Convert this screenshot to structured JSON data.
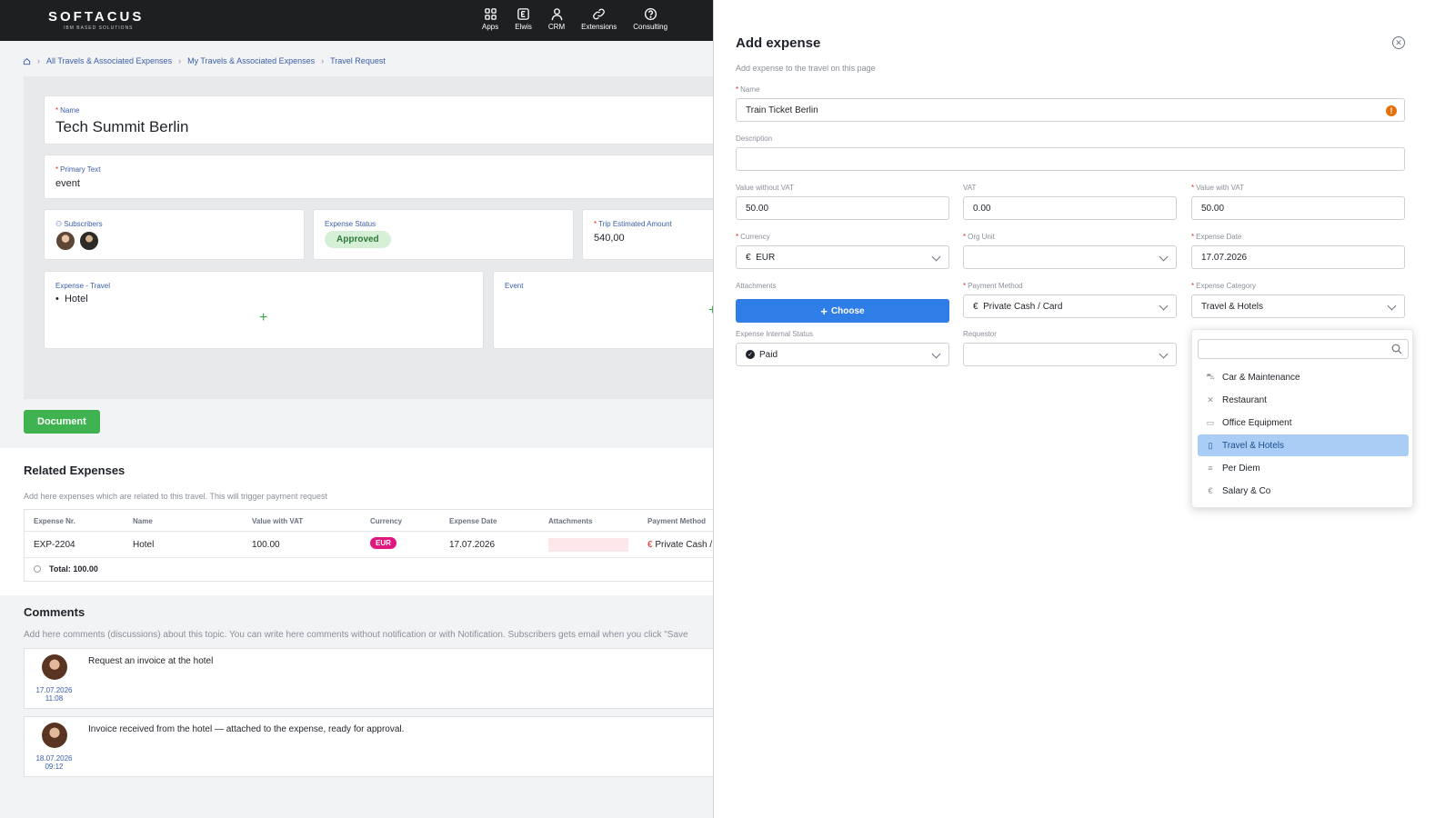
{
  "header": {
    "brand": "SOFTACUS",
    "brand_sub": "IBM BASED SOLUTIONS",
    "nav": [
      {
        "label": "Apps",
        "icon": "grid-icon"
      },
      {
        "label": "Elwis",
        "icon": "elwis-icon"
      },
      {
        "label": "CRM",
        "icon": "person-icon"
      },
      {
        "label": "Extensions",
        "icon": "link-icon"
      },
      {
        "label": "Consulting",
        "icon": "help-icon"
      }
    ]
  },
  "breadcrumb": [
    "All Travels & Associated Expenses",
    "My Travels & Associated Expenses",
    "Travel Request"
  ],
  "travel": {
    "name_label": "Name",
    "name": "Tech Summit Berlin",
    "primary_label": "Primary Text",
    "primary": "event",
    "subscribers_label": "Subscribers",
    "status_label": "Expense Status",
    "status": "Approved",
    "amount_label": "Trip Estimated Amount",
    "amount": "540,00",
    "expense_travel_label": "Expense - Travel",
    "expense_travel_items": [
      "Hotel"
    ],
    "event_label": "Event",
    "document_button": "Document"
  },
  "related": {
    "title": "Related Expenses",
    "desc": "Add here expenses which are related to this travel. This will trigger payment request",
    "columns": [
      "Expense Nr.",
      "Name",
      "Value with VAT",
      "Currency",
      "Expense Date",
      "Attachments",
      "Payment Method"
    ],
    "rows": [
      {
        "nr": "EXP-2204",
        "name": "Hotel",
        "value": "100.00",
        "currency": "EUR",
        "date": "17.07.2026",
        "payment_symbol": "€",
        "payment": "Private Cash /"
      }
    ],
    "total_label": "Total:",
    "total_value": "100.00"
  },
  "comments": {
    "title": "Comments",
    "desc": "Add here comments (discussions) about this topic. You can write here comments without notification or with Notification. Subscribers gets email when you click \"Save",
    "items": [
      {
        "date": "17.07.2026",
        "time": "11:08",
        "text": "Request an invoice at the hotel"
      },
      {
        "date": "18.07.2026",
        "time": "09:12",
        "text": "Invoice received from the hotel — attached to the expense, ready for approval."
      }
    ]
  },
  "panel": {
    "title": "Add expense",
    "subtitle": "Add expense  to the travel on this page",
    "name_label": "Name",
    "name_value": "Train Ticket Berlin",
    "description_label": "Description",
    "description_value": "",
    "value_wo_vat_label": "Value without VAT",
    "value_wo_vat": "50.00",
    "vat_label": "VAT",
    "vat": "0.00",
    "value_with_vat_label": "Value with VAT",
    "value_with_vat": "50.00",
    "currency_label": "Currency",
    "currency_symbol": "€",
    "currency": "EUR",
    "org_unit_label": "Org Unit",
    "org_unit": "",
    "expense_date_label": "Expense Date",
    "expense_date": "17.07.2026",
    "attachments_label": "Attachments",
    "choose_button": "Choose",
    "payment_method_label": "Payment Method",
    "payment_method_symbol": "€",
    "payment_method": "Private Cash / Card",
    "category_label": "Expense Category",
    "category": "Travel & Hotels",
    "internal_status_label": "Expense Internal Status",
    "internal_status": "Paid",
    "requestor_label": "Requestor",
    "requestor": ""
  },
  "category_options": [
    {
      "label": "Car & Maintenance",
      "icon": "car-icon",
      "selected": false
    },
    {
      "label": "Restaurant",
      "icon": "cutlery-icon",
      "selected": false
    },
    {
      "label": "Office Equipment",
      "icon": "monitor-icon",
      "selected": false
    },
    {
      "label": "Travel & Hotels",
      "icon": "building-icon",
      "selected": true
    },
    {
      "label": "Per Diem",
      "icon": "list-icon",
      "selected": false
    },
    {
      "label": "Salary & Co",
      "icon": "euro-icon",
      "selected": false
    }
  ],
  "colors": {
    "accent": "#2f7de6",
    "success": "#3fb34f",
    "currency_pill": "#e0177c",
    "warning": "#e8700a",
    "selected_option": "#a9cdf5"
  }
}
